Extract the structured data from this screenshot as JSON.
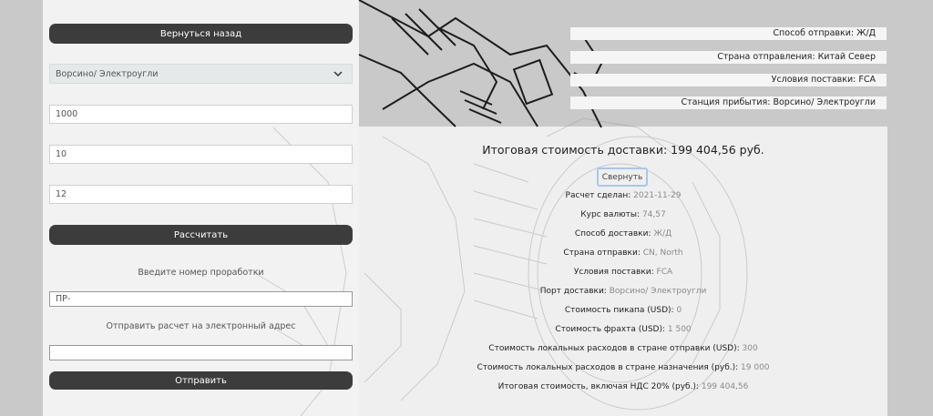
{
  "left_form": {
    "back_button": "Вернуться назад",
    "route_select_value": "Ворсино/ Электроугли",
    "field_1_value": "1000",
    "field_2_value": "10",
    "field_3_value": "12",
    "calculate_button": "Рассчитать",
    "enter_number_label": "Введите номер проработки",
    "number_input_placeholder": "ПР-",
    "email_label": "Отправить расчет на электронный адрес",
    "email_input_value": "",
    "send_button": "Отправить"
  },
  "summary": {
    "shipping_method": "Способ отправки: Ж/Д",
    "origin_country": "Страна отправления: Китай Север",
    "delivery_terms": "Условия поставки: FCA",
    "arrival_station": "Станция прибытия: Ворсино/ Электроугли"
  },
  "result": {
    "total_title": "Итоговая стоимость доставки: 199 404,56 руб.",
    "collapse_button": "Свернуть",
    "details": [
      {
        "label": "Расчет сделан:",
        "value": "2021-11-29"
      },
      {
        "label": "Курс валюты:",
        "value": "74,57"
      },
      {
        "label": "Способ доставки:",
        "value": "Ж/Д"
      },
      {
        "label": "Страна отправки:",
        "value": "CN, North"
      },
      {
        "label": "Условия поставки:",
        "value": "FCA"
      },
      {
        "label": "Порт доставки:",
        "value": "Ворсино/ Электроугли"
      },
      {
        "label": "Стоимость пикапа (USD):",
        "value": "0"
      },
      {
        "label": "Стоимость фрахта (USD):",
        "value": "1 500"
      },
      {
        "label": "Стоимость локальных расходов в стране отправки (USD):",
        "value": "300"
      },
      {
        "label": "Стоимость локальных расходов в стране назначения (руб.):",
        "value": "19 000"
      },
      {
        "label": "Итоговая стоимость, включая НДС 20% (руб.):",
        "value": "199 404,56"
      }
    ]
  },
  "icons": {
    "select_chevron": "chevron-down-icon"
  }
}
